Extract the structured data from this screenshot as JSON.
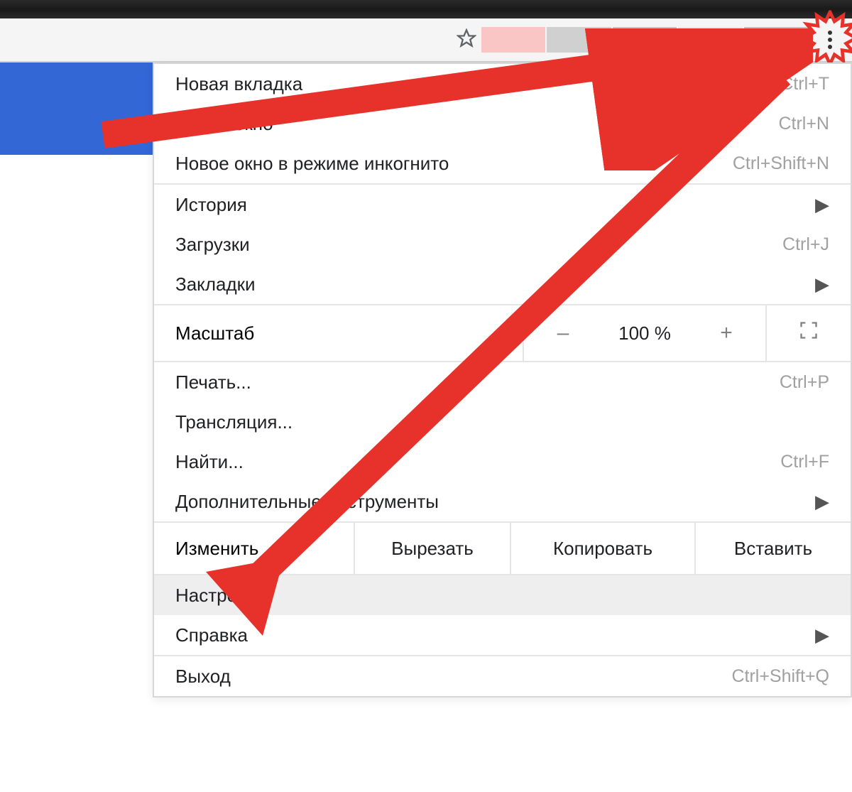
{
  "menu": {
    "newTab": {
      "label": "Новая вкладка",
      "shortcut": "Ctrl+T"
    },
    "newWindow": {
      "label": "Новое окно",
      "shortcut": "Ctrl+N"
    },
    "incognito": {
      "label": "Новое окно в режиме инкогнито",
      "shortcut": "Ctrl+Shift+N"
    },
    "history": {
      "label": "История"
    },
    "downloads": {
      "label": "Загрузки",
      "shortcut": "Ctrl+J"
    },
    "bookmarks": {
      "label": "Закладки"
    },
    "zoom": {
      "label": "Масштаб",
      "value": "100 %",
      "minus": "–",
      "plus": "+"
    },
    "print": {
      "label": "Печать...",
      "shortcut": "Ctrl+P"
    },
    "cast": {
      "label": "Трансляция..."
    },
    "find": {
      "label": "Найти...",
      "shortcut": "Ctrl+F"
    },
    "moreTools": {
      "label": "Дополнительные инструменты"
    },
    "edit": {
      "label": "Изменить",
      "cut": "Вырезать",
      "copy": "Копировать",
      "paste": "Вставить"
    },
    "settings": {
      "label": "Настройки"
    },
    "help": {
      "label": "Справка"
    },
    "exit": {
      "label": "Выход",
      "shortcut": "Ctrl+Shift+Q"
    }
  }
}
